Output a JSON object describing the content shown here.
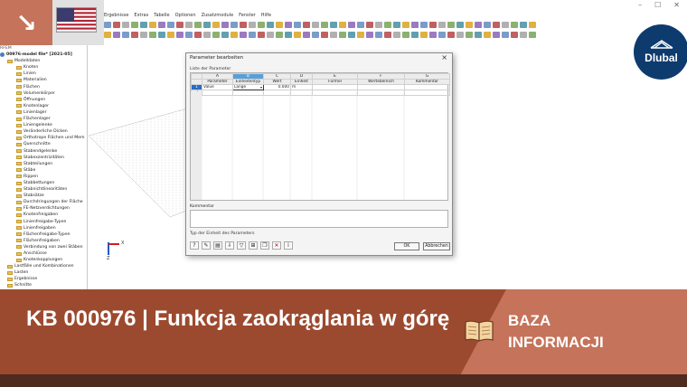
{
  "app": {
    "menu": [
      "Ergebnisse",
      "Extras",
      "Tabelle",
      "Optionen",
      "Zusatzmodule",
      "Fenster",
      "Hilfe"
    ],
    "tree": {
      "header": "RFEM",
      "root": "00976-model file* [2021-05]",
      "items": [
        "Modelldaten",
        "Knoten",
        "Linien",
        "Materialien",
        "Flächen",
        "Volumenkörper",
        "Öffnungen",
        "Knotenlager",
        "Linienlager",
        "Flächenlager",
        "Liniengelenke",
        "Veränderliche Dicken",
        "Orthotrope Flächen und Mem",
        "Querschnitte",
        "Stabendgelenke",
        "Stabexzentrizitäten",
        "Stabteilungen",
        "Stäbe",
        "Rippen",
        "Stabbettungen",
        "Stabnichtlinearitäten",
        "Stabsätze",
        "Durchdringungen der Fläche",
        "FE-Netzverdichtungen",
        "Knotenfreigaben",
        "Linienfreigabe-Typen",
        "Linienfreigaben",
        "Flächenfreigabe-Typen",
        "Flächenfreigaben",
        "Verbindung von zwei Stäben",
        "Anschlüsse",
        "Knotenkopplungen",
        "Lastfälle und Kombinationen",
        "Lasten",
        "Ergebnisse",
        "Schnitte"
      ]
    },
    "axes": {
      "x": "X",
      "z": "Z"
    }
  },
  "flag": {
    "icon": "us-flag-icon"
  },
  "logo": {
    "text": "Dlubal"
  },
  "dialog": {
    "title": "Parameter bearbeiten",
    "close": "×",
    "group_label": "Liste der Parameter",
    "letters": [
      "",
      "A",
      "B",
      "C",
      "D",
      "E",
      "F",
      "G"
    ],
    "headers": [
      "",
      "Parameter",
      "Einheitentyp",
      "Wert",
      "Einheit",
      "Formel",
      "Wertebereich",
      "Kommentar"
    ],
    "rows": [
      {
        "n": "1",
        "parameter": "Value",
        "type": "Länge",
        "value": "0.000",
        "unit": "m",
        "formula": "",
        "range": "",
        "comment": ""
      },
      {
        "n": "2",
        "parameter": "",
        "type": "",
        "value": "",
        "unit": "",
        "formula": "",
        "range": "",
        "comment": ""
      }
    ],
    "comment_label": "Kommentar",
    "status": "Typ der Einheit des Parameters",
    "ok": "OK",
    "cancel": "Abbrechen"
  },
  "banner": {
    "title": "KB 000976 | Funkcja zaokrąglania w górę",
    "badge_line1": "BAZA",
    "badge_line2": "INFORMACJI"
  },
  "colors": {
    "banner_light": "#c5735a",
    "banner_dark": "#9c4a2f",
    "footer": "#4e2a1f",
    "logo_blue": "#0d3b6e"
  }
}
